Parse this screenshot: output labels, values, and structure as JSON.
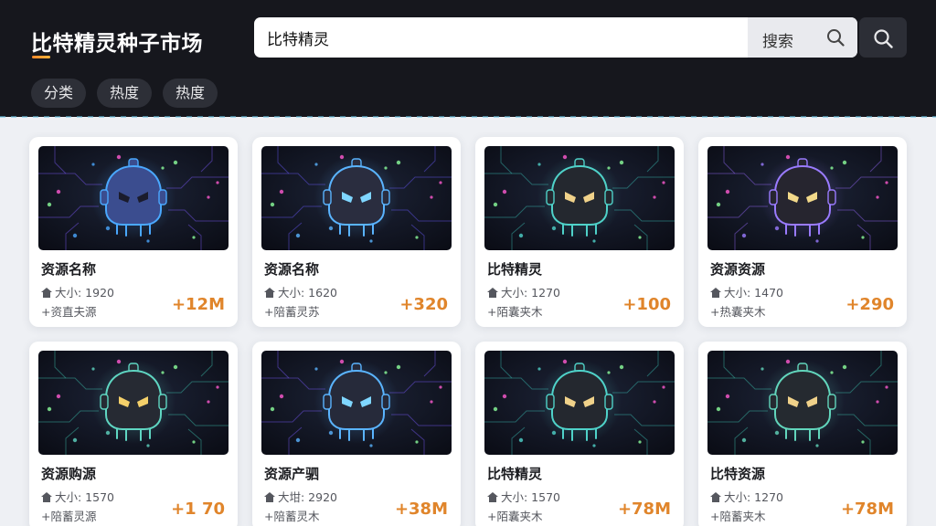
{
  "header": {
    "title": "比特精灵种子市场",
    "search": {
      "value": "比特精灵",
      "button_label": "搜索"
    },
    "chips": [
      "分类",
      "热度",
      "热度"
    ]
  },
  "cards": [
    {
      "title": "资源名称",
      "size": "大小: 1920",
      "desc": "+资直夫源",
      "count": "+12M",
      "accent": "#4aa8ff",
      "face": "#3b4d8f",
      "eyes": "#1b1c2c",
      "theme": "#7f5cff"
    },
    {
      "title": "资源名称",
      "size": "大小: 1620",
      "desc": "+陪蓄灵苏",
      "count": "+320",
      "accent": "#5ab4ff",
      "face": "#2a2d3f",
      "eyes": "#7fd6ff",
      "theme": "#6b5cff"
    },
    {
      "title": "比特精灵",
      "size": "大小: 1270",
      "desc": "+陌囊夹木",
      "count": "+100",
      "accent": "#4fd2c9",
      "face": "#24282f",
      "eyes": "#f0d28a",
      "theme": "#3cc0b8"
    },
    {
      "title": "资源资源",
      "size": "大小: 1470",
      "desc": "+热囊夹木",
      "count": "+290",
      "accent": "#9a7bff",
      "face": "#26252f",
      "eyes": "#f2d98a",
      "theme": "#9a6bff"
    },
    {
      "title": "资源购源",
      "size": "大小: 1570",
      "desc": "+陪蓄灵源",
      "count": "+1 70",
      "accent": "#5fd6c2",
      "face": "#262a33",
      "eyes": "#f4d06a",
      "theme": "#3fc6b1"
    },
    {
      "title": "资源产驷",
      "size": "大坩: 2920",
      "desc": "+陪蓄灵木",
      "count": "+38M",
      "accent": "#5ab4ff",
      "face": "#262a3a",
      "eyes": "#7fd6ff",
      "theme": "#7a5cff"
    },
    {
      "title": "比特精灵",
      "size": "大小: 1570",
      "desc": "+陌囊夹木",
      "count": "+78M",
      "accent": "#4fd2c9",
      "face": "#24282f",
      "eyes": "#f0d28a",
      "theme": "#3cc0b8"
    },
    {
      "title": "比特资源",
      "size": "大小: 1270",
      "desc": "+陪蓄夹木",
      "count": "+78M",
      "accent": "#62d6bc",
      "face": "#252a30",
      "eyes": "#f0d28a",
      "theme": "#3fc6b1"
    }
  ]
}
